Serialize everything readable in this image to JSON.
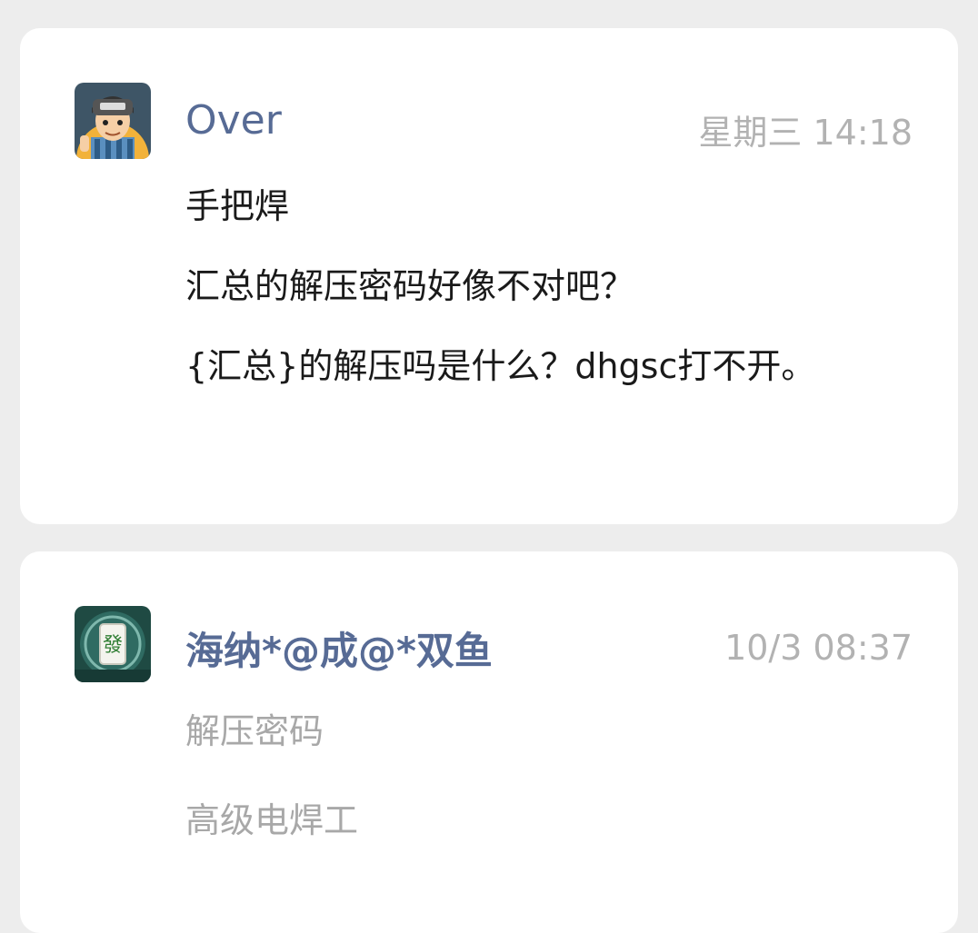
{
  "posts": [
    {
      "avatar_icon": "cartoon-boy-avatar-icon",
      "username": "Over",
      "timestamp": "星期三 14:18",
      "messages": [
        "手把焊",
        "汇总的解压密码好像不对吧？",
        "{汇总}的解压吗是什么？dhgsc打不开。"
      ]
    },
    {
      "avatar_icon": "mahjong-fa-tile-avatar-icon",
      "username": "海纳*@成@*双鱼",
      "timestamp": "10/3 08:37",
      "avatar_tile_char": "發",
      "messages": [
        "解压密码",
        "高级电焊工"
      ]
    }
  ],
  "colors": {
    "username": "#576b95",
    "timestamp": "#b2b2b2",
    "message": "#1a1a1a",
    "faded_message": "#a8a8a8",
    "background": "#ededed",
    "card": "#ffffff"
  }
}
